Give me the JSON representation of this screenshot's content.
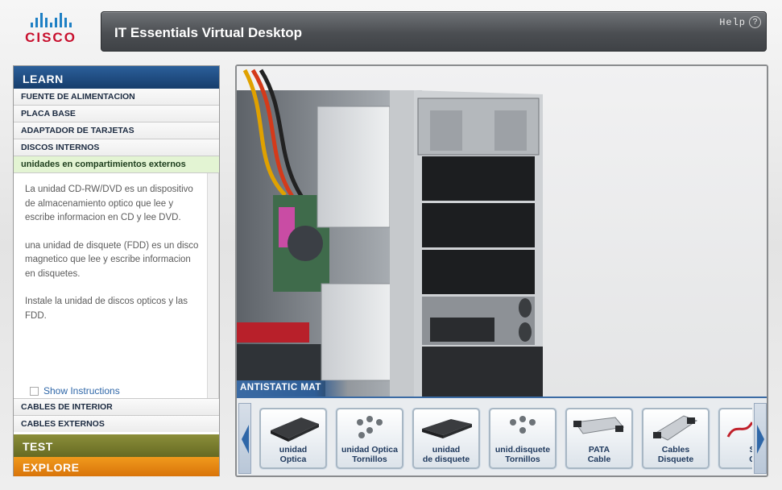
{
  "brand": {
    "logo_text": "CISCO"
  },
  "app": {
    "title": "IT Essentials Virtual Desktop",
    "help_label": "Help",
    "help_icon": "?"
  },
  "sidebar": {
    "header": "LEARN",
    "items": [
      {
        "label": "FUENTE DE ALIMENTACION"
      },
      {
        "label": "PLACA BASE"
      },
      {
        "label": "ADAPTADOR DE TARJETAS"
      },
      {
        "label": "DISCOS INTERNOS"
      },
      {
        "label": "unidades en compartimientos externos",
        "active": true
      }
    ],
    "description": [
      "La unidad CD-RW/DVD es un dispositivo de almacenamiento optico que lee y escribe informacion en CD y lee DVD.",
      "una unidad de disquete (FDD) es un disco magnetico que lee y escribe informacion en disquetes.",
      "Instale la unidad de discos opticos y las FDD."
    ],
    "show_instructions": "Show Instructions",
    "sub_items": [
      {
        "label": "CABLES DE INTERIOR"
      },
      {
        "label": "CABLES EXTERNOS"
      }
    ],
    "test_label": "TEST",
    "explore_label": "EXPLORE"
  },
  "workspace": {
    "mat_label": "ANTISTATIC MAT"
  },
  "tray": {
    "items": [
      {
        "line1": "unidad",
        "line2": "Optica",
        "icon": "optical-drive-icon"
      },
      {
        "line1": "unidad Optica",
        "line2": "Tornillos",
        "icon": "screws-icon"
      },
      {
        "line1": "unidad",
        "line2": "de disquete",
        "icon": "floppy-drive-icon"
      },
      {
        "line1": "unid.disquete",
        "line2": "Tornillos",
        "icon": "screws-icon"
      },
      {
        "line1": "PATA",
        "line2": "Cable",
        "icon": "pata-cable-icon"
      },
      {
        "line1": "Cables",
        "line2": "Disquete",
        "icon": "floppy-cable-icon"
      },
      {
        "line1": "S",
        "line2": "C",
        "icon": "sata-cable-icon"
      }
    ]
  },
  "colors": {
    "learn": "#1f4e85",
    "test": "#7a7d2e",
    "explore": "#e8850f",
    "active_item": "#e3f4d3",
    "accent": "#3b6ba4"
  }
}
